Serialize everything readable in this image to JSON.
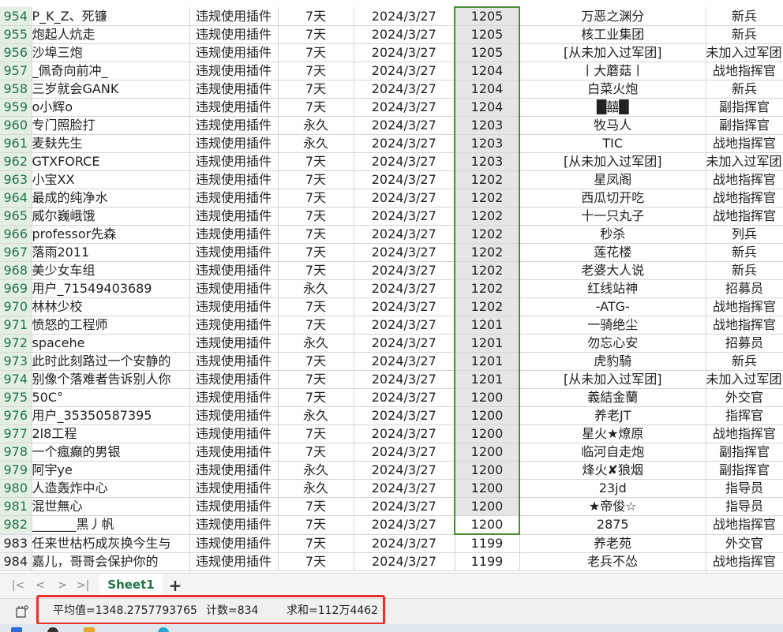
{
  "rows": [
    {
      "num": "954",
      "name": "P_K_Z、死镰",
      "reason": "违规使用插件",
      "duration": "7天",
      "date": "2024/3/27",
      "score": "1205",
      "group": "万恶之渊分",
      "rank": "新兵"
    },
    {
      "num": "955",
      "name": "炮起人炕走",
      "reason": "违规使用插件",
      "duration": "7天",
      "date": "2024/3/27",
      "score": "1205",
      "group": "核工业集团",
      "rank": "新兵"
    },
    {
      "num": "956",
      "name": "沙埠三炮",
      "reason": "违规使用插件",
      "duration": "7天",
      "date": "2024/3/27",
      "score": "1205",
      "group": "[从未加入过军团]",
      "rank": "未加入过军团]"
    },
    {
      "num": "957",
      "name": "_佩奇向前冲_",
      "reason": "违规使用插件",
      "duration": "7天",
      "date": "2024/3/27",
      "score": "1204",
      "group": "丨大蘑菇丨",
      "rank": "战地指挥官"
    },
    {
      "num": "958",
      "name": "三岁就会GANK",
      "reason": "违规使用插件",
      "duration": "7天",
      "date": "2024/3/27",
      "score": "1204",
      "group": "白菜火炮",
      "rank": "新兵"
    },
    {
      "num": "959",
      "name": "o小辉o",
      "reason": "违规使用插件",
      "duration": "7天",
      "date": "2024/3/27",
      "score": "1204",
      "group": "█囍█",
      "rank": "副指挥官"
    },
    {
      "num": "960",
      "name": "专门照脸打",
      "reason": "违规使用插件",
      "duration": "永久",
      "date": "2024/3/27",
      "score": "1203",
      "group": "牧马人",
      "rank": "副指挥官"
    },
    {
      "num": "961",
      "name": "麦麸先生",
      "reason": "违规使用插件",
      "duration": "永久",
      "date": "2024/3/27",
      "score": "1203",
      "group": "TIC",
      "rank": "战地指挥官"
    },
    {
      "num": "962",
      "name": "GTXFORCE",
      "reason": "违规使用插件",
      "duration": "7天",
      "date": "2024/3/27",
      "score": "1203",
      "group": "[从未加入过军团]",
      "rank": "未加入过军团]"
    },
    {
      "num": "963",
      "name": "小宝XX",
      "reason": "违规使用插件",
      "duration": "7天",
      "date": "2024/3/27",
      "score": "1202",
      "group": "星凤阁",
      "rank": "战地指挥官"
    },
    {
      "num": "964",
      "name": "最成的纯净水",
      "reason": "违规使用插件",
      "duration": "7天",
      "date": "2024/3/27",
      "score": "1202",
      "group": "西瓜切开吃",
      "rank": "战地指挥官"
    },
    {
      "num": "965",
      "name": "威尔巍峨饿",
      "reason": "违规使用插件",
      "duration": "7天",
      "date": "2024/3/27",
      "score": "1202",
      "group": "十一只丸子",
      "rank": "战地指挥官"
    },
    {
      "num": "966",
      "name": "professor先森",
      "reason": "违规使用插件",
      "duration": "7天",
      "date": "2024/3/27",
      "score": "1202",
      "group": "秒杀",
      "rank": "列兵"
    },
    {
      "num": "967",
      "name": "落雨2011",
      "reason": "违规使用插件",
      "duration": "7天",
      "date": "2024/3/27",
      "score": "1202",
      "group": "莲花楼",
      "rank": "新兵"
    },
    {
      "num": "968",
      "name": "美少女车组",
      "reason": "违规使用插件",
      "duration": "7天",
      "date": "2024/3/27",
      "score": "1202",
      "group": "老婆大人说",
      "rank": "新兵"
    },
    {
      "num": "969",
      "name": "用户_71549403689",
      "reason": "违规使用插件",
      "duration": "永久",
      "date": "2024/3/27",
      "score": "1202",
      "group": "红线站神",
      "rank": "招募员"
    },
    {
      "num": "970",
      "name": "林林少校",
      "reason": "违规使用插件",
      "duration": "7天",
      "date": "2024/3/27",
      "score": "1202",
      "group": "-ATG-",
      "rank": "战地指挥官"
    },
    {
      "num": "971",
      "name": "愤怒的工程师",
      "reason": "违规使用插件",
      "duration": "7天",
      "date": "2024/3/27",
      "score": "1201",
      "group": "一骑绝尘",
      "rank": "战地指挥官"
    },
    {
      "num": "972",
      "name": "spacehe",
      "reason": "违规使用插件",
      "duration": "永久",
      "date": "2024/3/27",
      "score": "1201",
      "group": "勿忘心安",
      "rank": "招募员"
    },
    {
      "num": "973",
      "name": "此时此刻路过一个安静的",
      "reason": "违规使用插件",
      "duration": "7天",
      "date": "2024/3/27",
      "score": "1201",
      "group": "虎豹騎",
      "rank": "新兵"
    },
    {
      "num": "974",
      "name": "别像个落难者告诉别人你",
      "reason": "违规使用插件",
      "duration": "7天",
      "date": "2024/3/27",
      "score": "1201",
      "group": "[从未加入过军团]",
      "rank": "未加入过军团]"
    },
    {
      "num": "975",
      "name": "50C°",
      "reason": "违规使用插件",
      "duration": "7天",
      "date": "2024/3/27",
      "score": "1200",
      "group": "義結金蘭",
      "rank": "外交官"
    },
    {
      "num": "976",
      "name": "用户_35350587395",
      "reason": "违规使用插件",
      "duration": "永久",
      "date": "2024/3/27",
      "score": "1200",
      "group": "养老JT",
      "rank": "指挥官"
    },
    {
      "num": "977",
      "name": "2l8工程",
      "reason": "违规使用插件",
      "duration": "7天",
      "date": "2024/3/27",
      "score": "1200",
      "group": "星火★燎原",
      "rank": "战地指挥官"
    },
    {
      "num": "978",
      "name": "一个瘋癲的男银",
      "reason": "违规使用插件",
      "duration": "7天",
      "date": "2024/3/27",
      "score": "1200",
      "group": "临河自走炮",
      "rank": "副指挥官"
    },
    {
      "num": "979",
      "name": "阿宇ye",
      "reason": "违规使用插件",
      "duration": "永久",
      "date": "2024/3/27",
      "score": "1200",
      "group": "烽火✘狼烟",
      "rank": "副指挥官"
    },
    {
      "num": "980",
      "name": "人造轰炸中心",
      "reason": "违规使用插件",
      "duration": "永久",
      "date": "2024/3/27",
      "score": "1200",
      "group": "23jd",
      "rank": "指导员"
    },
    {
      "num": "981",
      "name": "混世無心",
      "reason": "违规使用插件",
      "duration": "7天",
      "date": "2024/3/27",
      "score": "1200",
      "group": "★帝俊☆",
      "rank": "指导员"
    },
    {
      "num": "982",
      "name": "_______黑丿帆",
      "reason": "违规使用插件",
      "duration": "7天",
      "date": "2024/3/27",
      "score": "1200",
      "group": "2875",
      "rank": "战地指挥官"
    },
    {
      "num": "983",
      "name": "任来世枯朽成灰换今生与",
      "reason": "违规使用插件",
      "duration": "7天",
      "date": "2024/3/27",
      "score": "1199",
      "group": "养老苑",
      "rank": "外交官"
    },
    {
      "num": "984",
      "name": "嘉儿，哥哥会保护你的",
      "reason": "违规使用插件",
      "duration": "7天",
      "date": "2024/3/27",
      "score": "1199",
      "group": "老兵不怂",
      "rank": "战地指挥官"
    }
  ],
  "tabs": {
    "active_sheet": "Sheet1",
    "add_sheet": "+"
  },
  "nav": {
    "first": "|<",
    "prev": "<",
    "next": ">",
    "last": ">|"
  },
  "status": {
    "average": "平均值=1348.2757793765",
    "count": "计数=834",
    "sum": "求和=112万4462"
  },
  "colors": {
    "accent": "#217346",
    "selection_border": "#4a8a3a",
    "highlight_box": "#e8302a"
  }
}
